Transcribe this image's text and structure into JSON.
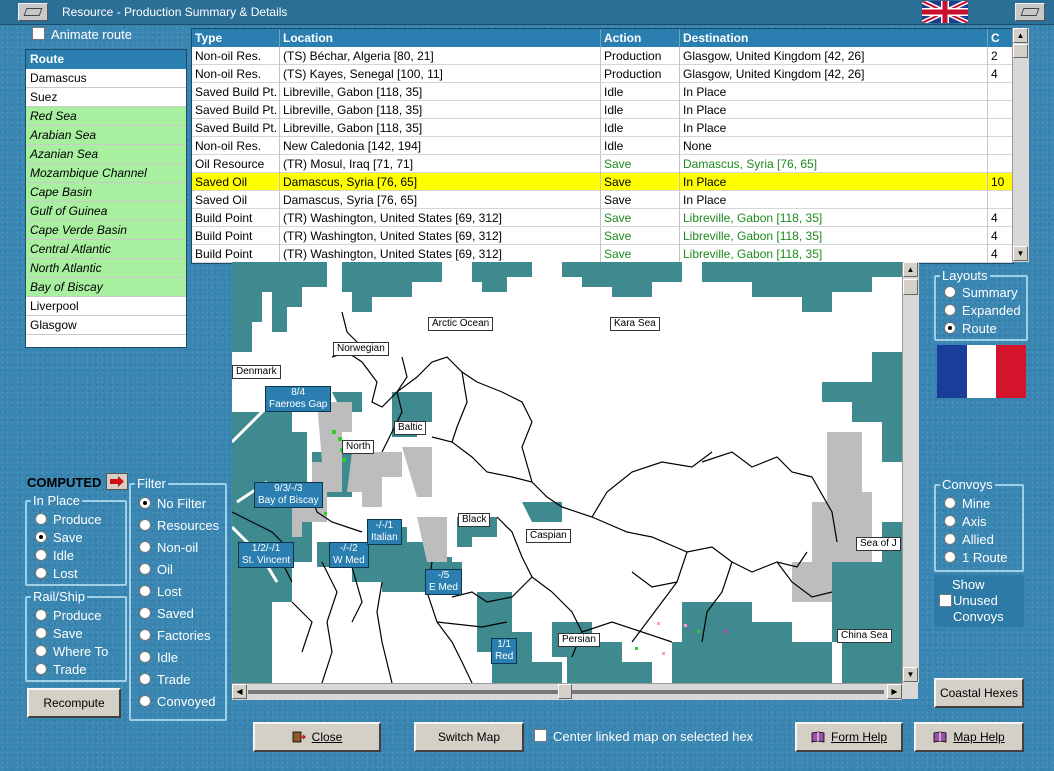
{
  "window": {
    "title": "Resource - Production Summary & Details"
  },
  "animate_route": {
    "label": "Animate route",
    "checked": false
  },
  "route_list": {
    "header": "Route",
    "items": [
      {
        "name": "Damascus",
        "sea": false
      },
      {
        "name": "Suez",
        "sea": false
      },
      {
        "name": "Red Sea",
        "sea": true
      },
      {
        "name": "Arabian Sea",
        "sea": true
      },
      {
        "name": "Azanian Sea",
        "sea": true
      },
      {
        "name": "Mozambique Channel",
        "sea": true
      },
      {
        "name": "Cape Basin",
        "sea": true
      },
      {
        "name": "Gulf of Guinea",
        "sea": true
      },
      {
        "name": "Cape Verde Basin",
        "sea": true
      },
      {
        "name": "Central Atlantic",
        "sea": true
      },
      {
        "name": "North Atlantic",
        "sea": true
      },
      {
        "name": "Bay of Biscay",
        "sea": true
      },
      {
        "name": "Liverpool",
        "sea": false
      },
      {
        "name": "Glasgow",
        "sea": false
      }
    ]
  },
  "details_table": {
    "columns": [
      "Type",
      "Location",
      "Action",
      "Destination",
      "C"
    ],
    "rows": [
      {
        "type": "Non-oil Res.",
        "location": "(TS) Béchar, Algeria [80, 21]",
        "action": "Production",
        "destination": "Glasgow, United Kingdom [42, 26]",
        "c": "2",
        "green": false,
        "selected": false
      },
      {
        "type": "Non-oil Res.",
        "location": "(TS) Kayes, Senegal [100, 11]",
        "action": "Production",
        "destination": "Glasgow, United Kingdom [42, 26]",
        "c": "4",
        "green": false,
        "selected": false
      },
      {
        "type": "Saved Build Pt.",
        "location": "Libreville, Gabon [118, 35]",
        "action": "Idle",
        "destination": "In Place",
        "c": "",
        "green": false,
        "selected": false
      },
      {
        "type": "Saved Build Pt.",
        "location": "Libreville, Gabon [118, 35]",
        "action": "Idle",
        "destination": "In Place",
        "c": "",
        "green": false,
        "selected": false
      },
      {
        "type": "Saved Build Pt.",
        "location": "Libreville, Gabon [118, 35]",
        "action": "Idle",
        "destination": "In Place",
        "c": "",
        "green": false,
        "selected": false
      },
      {
        "type": "Non-oil Res.",
        "location": "New Caledonia [142, 194]",
        "action": "Idle",
        "destination": "None",
        "c": "",
        "green": false,
        "selected": false
      },
      {
        "type": "Oil Resource",
        "location": "(TR) Mosul, Iraq [71, 71]",
        "action": "Save",
        "destination": "Damascus, Syria [76, 65]",
        "c": "",
        "green": true,
        "selected": false
      },
      {
        "type": "Saved Oil",
        "location": "Damascus, Syria [76, 65]",
        "action": "Save",
        "destination": "In Place",
        "c": "10",
        "green": false,
        "selected": true
      },
      {
        "type": "Saved Oil",
        "location": "Damascus, Syria [76, 65]",
        "action": "Save",
        "destination": "In Place",
        "c": "",
        "green": false,
        "selected": false
      },
      {
        "type": "Build Point",
        "location": "(TR) Washington, United States [69, 312]",
        "action": "Save",
        "destination": "Libreville, Gabon [118, 35]",
        "c": "4",
        "green": true,
        "selected": false
      },
      {
        "type": "Build Point",
        "location": "(TR) Washington, United States [69, 312]",
        "action": "Save",
        "destination": "Libreville, Gabon [118, 35]",
        "c": "4",
        "green": true,
        "selected": false
      },
      {
        "type": "Build Point",
        "location": "(TR) Washington, United States [69, 312]",
        "action": "Save",
        "destination": "Libreville, Gabon [118, 35]",
        "c": "4",
        "green": true,
        "selected": false
      }
    ]
  },
  "layouts": {
    "title": "Layouts",
    "options": [
      "Summary",
      "Expanded",
      "Route"
    ],
    "selected": "Route"
  },
  "convoys": {
    "title": "Convoys",
    "options": [
      "Mine",
      "Axis",
      "Allied",
      "1 Route"
    ],
    "selected": "none"
  },
  "show_unused": {
    "line1": "Show",
    "line2": "Unused",
    "line3": "Convoys",
    "checked": false
  },
  "coastal_hexes_button": "Coastal Hexes",
  "computed": {
    "label": "COMPUTED"
  },
  "in_place": {
    "title": "In Place",
    "options": [
      "Produce",
      "Save",
      "Idle",
      "Lost"
    ],
    "selected": "Save"
  },
  "rail_ship": {
    "title": "Rail/Ship",
    "options": [
      "Produce",
      "Save",
      "Where To",
      "Trade"
    ],
    "selected": "none"
  },
  "recompute_button": "Recompute",
  "filter": {
    "title": "Filter",
    "options": [
      "No Filter",
      "Resources",
      "Non-oil",
      "Oil",
      "Lost",
      "Saved",
      "Factories",
      "Idle",
      "Trade",
      "Convoyed"
    ],
    "selected": "No Filter"
  },
  "map": {
    "place_labels": [
      {
        "id": "arctic",
        "text": "Arctic Ocean"
      },
      {
        "id": "kara",
        "text": "Kara Sea"
      },
      {
        "id": "norwegian",
        "text": "Norwegian"
      },
      {
        "id": "denmark",
        "text": "Denmark"
      },
      {
        "id": "baltic",
        "text": "Baltic"
      },
      {
        "id": "north",
        "text": "North"
      },
      {
        "id": "black",
        "text": "Black"
      },
      {
        "id": "caspian",
        "text": "Caspian"
      },
      {
        "id": "persian",
        "text": "Persian"
      },
      {
        "id": "seaofj",
        "text": "Sea of J"
      },
      {
        "id": "chinasea",
        "text": "China Sea"
      }
    ],
    "route_labels": [
      {
        "id": "faeroes",
        "top": "8/4",
        "bottom": "Faeroes Gap"
      },
      {
        "id": "biscay",
        "top": "9/3/-/3",
        "bottom": "Bay of Biscay"
      },
      {
        "id": "stvincent",
        "top": "1/2/-/1",
        "bottom": "St. Vincent"
      },
      {
        "id": "wmed",
        "top": "-/-/2",
        "bottom": "W Med"
      },
      {
        "id": "italian",
        "top": "-/-/1",
        "bottom": "Italian"
      },
      {
        "id": "emed",
        "top": "-/5",
        "bottom": "E Med"
      },
      {
        "id": "red",
        "top": "1/1",
        "bottom": "Red"
      }
    ]
  },
  "bottom_bar": {
    "close": "Close",
    "switch_map": "Switch Map",
    "center_linked": "Center linked map on selected hex",
    "form_help": "Form Help",
    "map_help": "Map Help"
  },
  "colors": {
    "accent": "#2a7fb0",
    "selected_row": "#ffff00",
    "sea_route": "#a8f0a0",
    "map_sea": "#3e8a8e",
    "map_land": "#ffffff",
    "map_unit": "#bdbdbd"
  }
}
